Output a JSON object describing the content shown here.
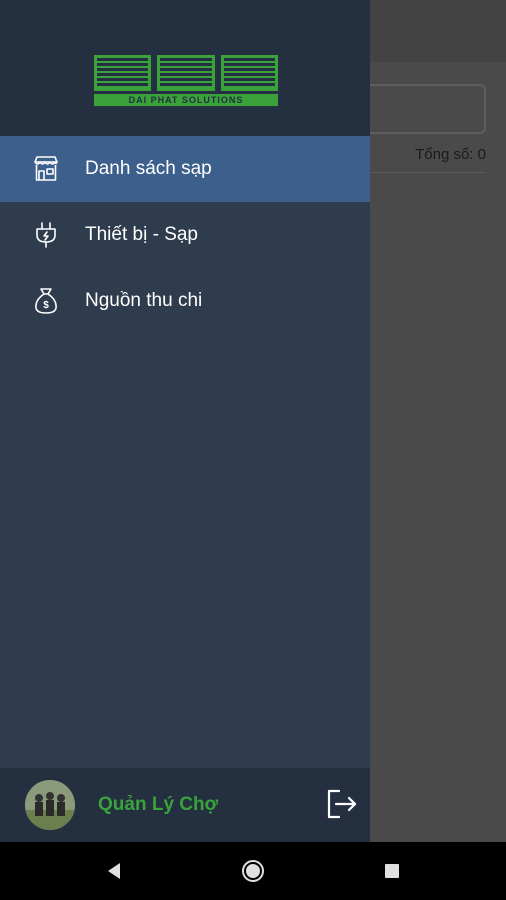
{
  "background": {
    "total_label": "Tổng số: 0"
  },
  "drawer": {
    "logo": {
      "letters": "DPS",
      "tagline": "DAI PHAT SOLUTIONS"
    },
    "menu_items": [
      {
        "label": "Danh sách sạp",
        "icon": "storefront-icon",
        "active": true
      },
      {
        "label": "Thiết bị - Sạp",
        "icon": "plug-icon",
        "active": false
      },
      {
        "label": "Nguồn thu chi",
        "icon": "money-bag-icon",
        "active": false
      }
    ],
    "footer": {
      "user_name": "Quản Lý Chợ"
    }
  },
  "colors": {
    "drawer_bg": "#2f3c4d",
    "header_bg": "#243040",
    "active_item": "#3d5f8c",
    "brand_green": "#3aa23a"
  }
}
